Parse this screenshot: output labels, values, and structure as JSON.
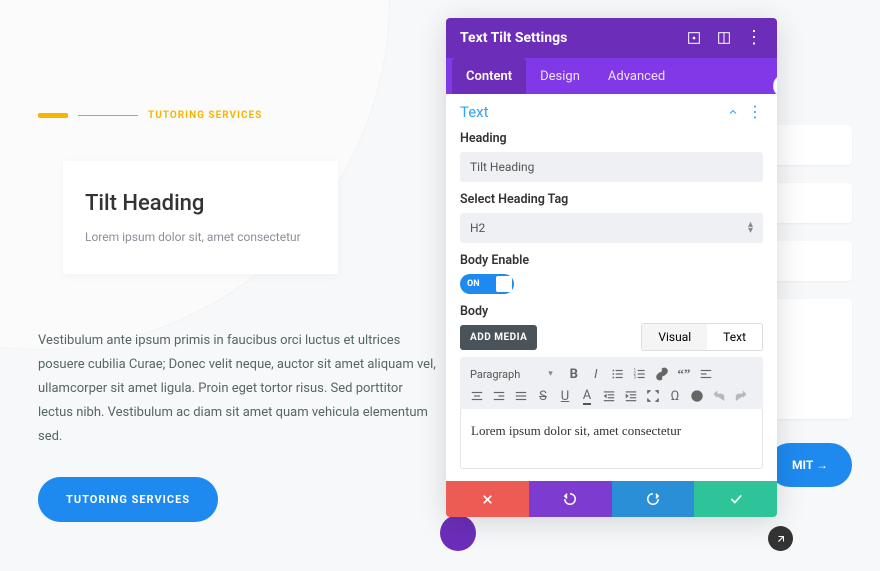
{
  "page": {
    "tagline": "TUTORING SERVICES",
    "card_heading": "Tilt Heading",
    "card_sub": "Lorem ipsum dolor sit, amet consectetur",
    "paragraph": "Vestibulum ante ipsum primis in faucibus orci luctus et ultrices posuere cubilia Curae; Donec velit neque, auctor sit amet aliquam vel, ullamcorper sit amet ligula. Proin eget tortor risus. Sed porttitor lectus nibh. Vestibulum ac diam sit amet quam vehicula elementum sed.",
    "cta_label": "TUTORING SERVICES",
    "submit_label": "MIT →"
  },
  "panel": {
    "title": "Text Tilt Settings",
    "tabs": {
      "content": "Content",
      "design": "Design",
      "advanced": "Advanced"
    },
    "section_title": "Text",
    "fields": {
      "heading_label": "Heading",
      "heading_value": "Tilt Heading",
      "select_tag_label": "Select Heading Tag",
      "select_tag_value": "H2",
      "body_enable_label": "Body Enable",
      "toggle_state": "ON",
      "body_label": "Body",
      "add_media": "ADD MEDIA",
      "visual_tab": "Visual",
      "text_tab": "Text",
      "format_select": "Paragraph",
      "editor_content": "Lorem ipsum dolor sit, amet consectetur"
    }
  },
  "colors": {
    "purple_dark": "#6c2eb9",
    "purple_light": "#8139e8",
    "blue": "#1e8af0",
    "teal": "#2fc39a",
    "red": "#ec5b54"
  }
}
